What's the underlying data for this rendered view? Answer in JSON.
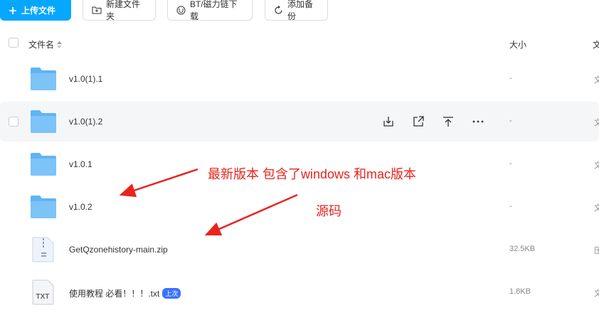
{
  "toolbar": {
    "upload_label": "上传文件",
    "new_folder_label": "新建文件夹",
    "bt_label": "BT/磁力链下载",
    "backup_label": "添加备份"
  },
  "header": {
    "name_label": "文件名",
    "size_label": "大小",
    "type_label": "文"
  },
  "files": [
    {
      "name": "v1.0(1).1",
      "size": "-",
      "type": "文"
    },
    {
      "name": "v1.0(1).2",
      "size": "-",
      "type": "文"
    },
    {
      "name": "v1.0.1",
      "size": "-",
      "type": "文"
    },
    {
      "name": "v1.0.2",
      "size": "-",
      "type": "文"
    },
    {
      "name": "GetQzonehistory-main.zip",
      "size": "32.5KB",
      "type": "压"
    },
    {
      "name": "使用教程 必看！！！.txt",
      "size": "1.8KB",
      "type": "文",
      "badge": "上次",
      "icon_text": "TXT"
    }
  ],
  "annotations": {
    "note1": "最新版本 包含了windows 和mac版本",
    "note2": "源码"
  },
  "colors": {
    "accent": "#06a7ff",
    "folder": "#5fb4f5",
    "annotation": "#e8241c"
  }
}
